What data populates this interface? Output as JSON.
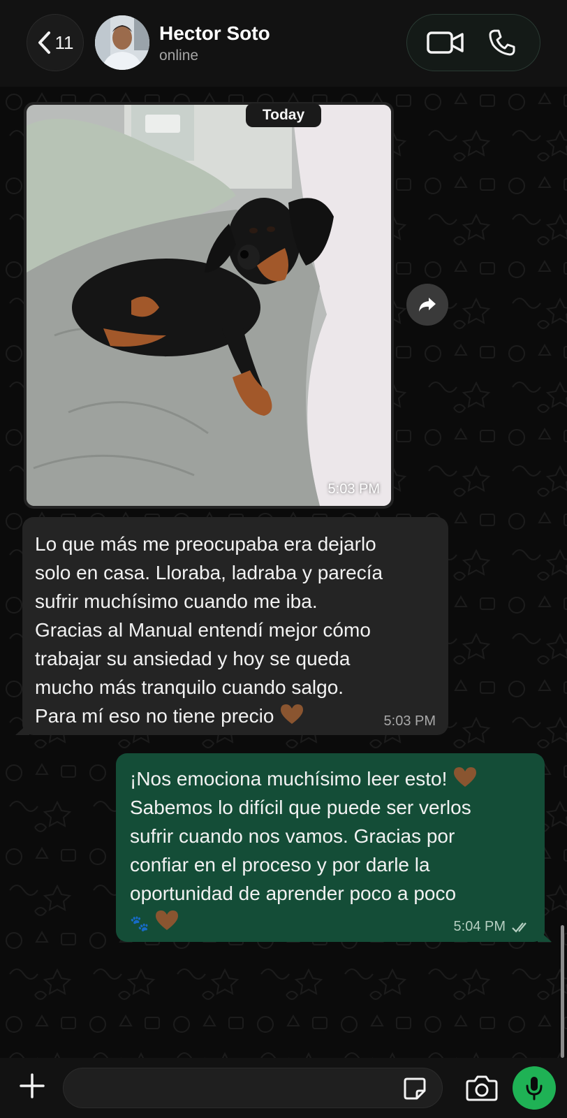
{
  "header": {
    "back_count": "11",
    "contact_name": "Hector Soto",
    "contact_status": "online",
    "video_call_icon": "video-camera-icon",
    "voice_call_icon": "phone-icon"
  },
  "chat": {
    "date_label": "Today",
    "image_message": {
      "time": "5:03 PM"
    },
    "incoming_message": {
      "lines": [
        "Lo que más me preocupaba era dejarlo",
        "solo en casa. Lloraba, ladraba y parecía",
        "sufrir muchísimo cuando me iba.",
        "Gracias al Manual entendí mejor cómo",
        "trabajar su ansiedad y hoy se queda",
        "mucho más tranquilo cuando salgo.",
        "Para mí eso no tiene precio"
      ],
      "time": "5:03 PM"
    },
    "outgoing_message": {
      "lines": [
        "¡Nos emociona muchísimo leer esto!",
        "Sabemos lo difícil que puede ser verlos",
        "sufrir cuando nos vamos. Gracias por",
        "confiar en el proceso y por darle la",
        "oportunidad de aprender poco a poco"
      ],
      "paw_emoji": "🐾",
      "time": "5:04 PM",
      "status_icon": "double-check-icon"
    }
  },
  "composer": {
    "placeholder": "",
    "accent_color": "#1fb255"
  },
  "colors": {
    "incoming_bubble": "#242424",
    "outgoing_bubble": "#144d37",
    "heart": "#8a5530"
  }
}
